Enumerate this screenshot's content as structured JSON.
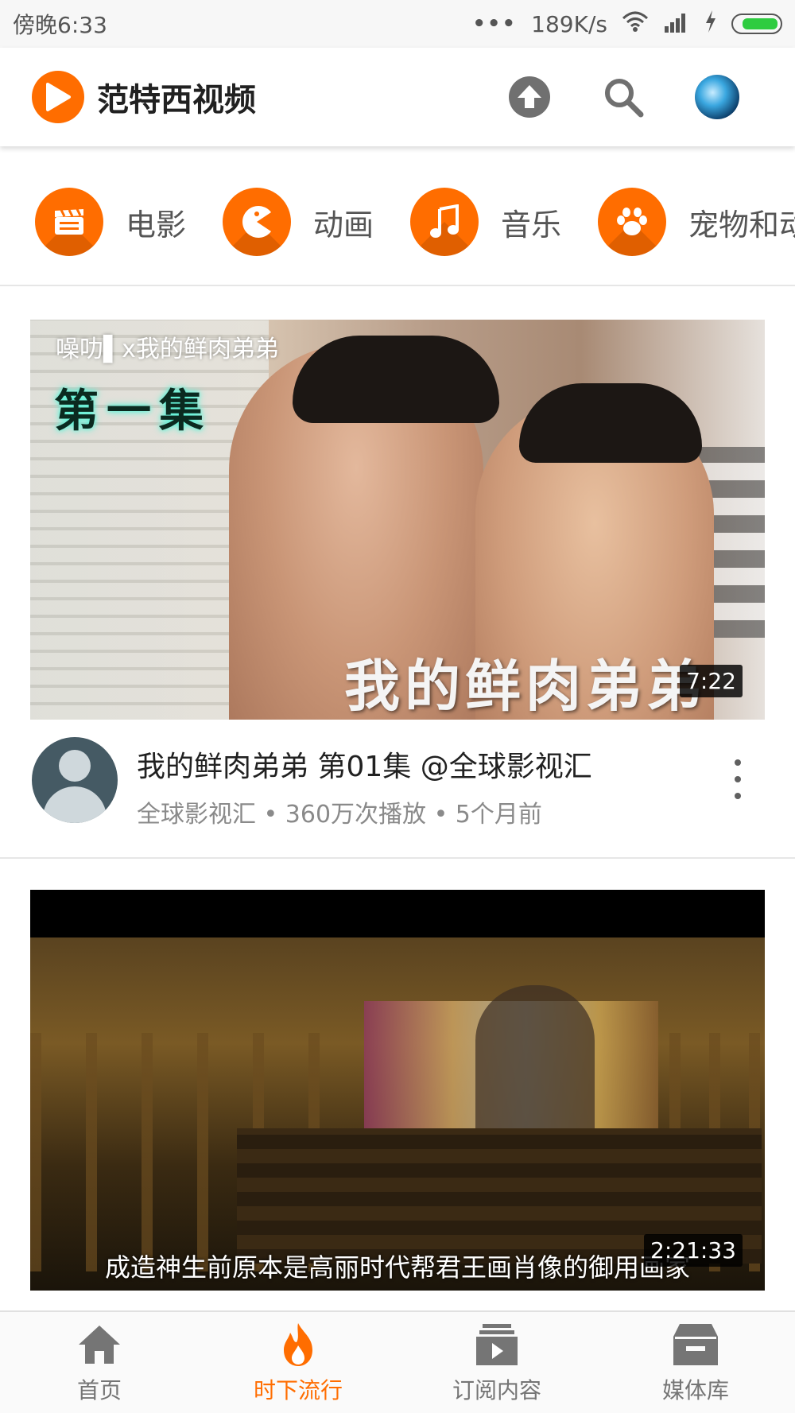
{
  "status_bar": {
    "time": "傍晚6:33",
    "dots": "•••",
    "net_speed": "189K/s"
  },
  "header": {
    "app_title": "范特西视频",
    "brand_color": "#ff6d00"
  },
  "categories": [
    {
      "label": "电影",
      "icon": "clapperboard-icon"
    },
    {
      "label": "动画",
      "icon": "pacman-icon"
    },
    {
      "label": "音乐",
      "icon": "music-note-icon"
    },
    {
      "label": "宠物和动",
      "icon": "paw-icon"
    }
  ],
  "videos": [
    {
      "title": "我的鲜肉弟弟 第01集 @全球影视汇",
      "channel": "全球影视汇",
      "views": "360万次播放",
      "age": "5个月前",
      "subline": "全球影视汇 • 360万次播放 • 5个月前",
      "duration": "7:22",
      "overlay_brand": "噪叻▌x我的鲜肉弟弟",
      "overlay_episode": "第一集",
      "overlay_title": "我的鲜肉弟弟"
    },
    {
      "duration": "2:21:33",
      "subtitle": "成造神生前原本是高丽时代帮君王画肖像的御用画家"
    }
  ],
  "bottom_nav": [
    {
      "label": "首页",
      "icon": "home-icon",
      "active": false
    },
    {
      "label": "时下流行",
      "icon": "flame-icon",
      "active": true
    },
    {
      "label": "订阅内容",
      "icon": "subscriptions-icon",
      "active": false
    },
    {
      "label": "媒体库",
      "icon": "library-icon",
      "active": false
    }
  ]
}
